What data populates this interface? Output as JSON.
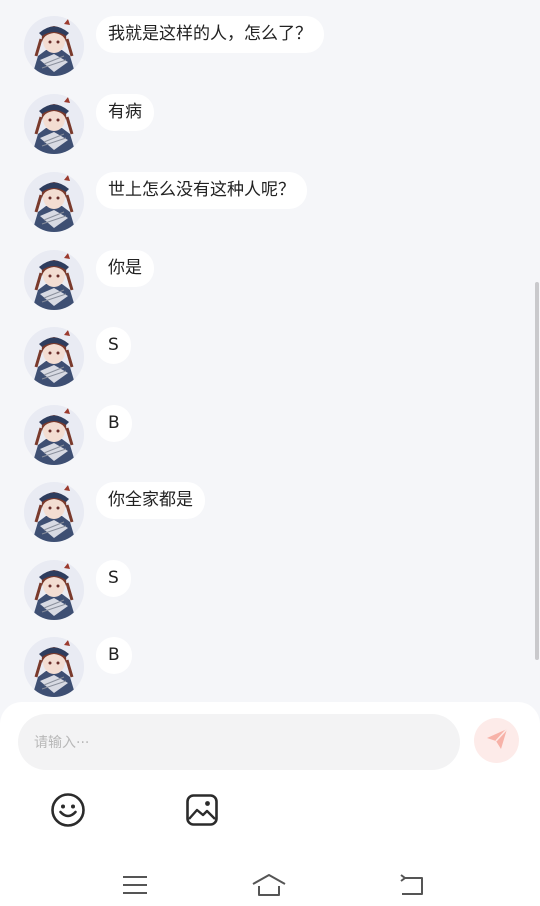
{
  "chat": {
    "messages": [
      {
        "text": "我就是这样的人，怎么了？"
      },
      {
        "text": "有病"
      },
      {
        "text": "世上怎么没有这种人呢？"
      },
      {
        "text": "你是"
      },
      {
        "text": "S"
      },
      {
        "text": "B"
      },
      {
        "text": "你全家都是"
      },
      {
        "text": "S"
      },
      {
        "text": "B"
      }
    ]
  },
  "composer": {
    "input_placeholder": "请输入···",
    "input_value": "",
    "send_icon": "paper-plane-icon",
    "emoji_icon": "smiley-icon",
    "image_icon": "image-icon"
  },
  "navigation": {
    "menu_icon": "menu-icon",
    "home_icon": "home-icon",
    "back_icon": "back-icon"
  },
  "colors": {
    "background": "#f5f6f9",
    "bubble": "#ffffff",
    "send_button_bg": "#fdebe9",
    "send_icon": "#f7b2a8"
  }
}
